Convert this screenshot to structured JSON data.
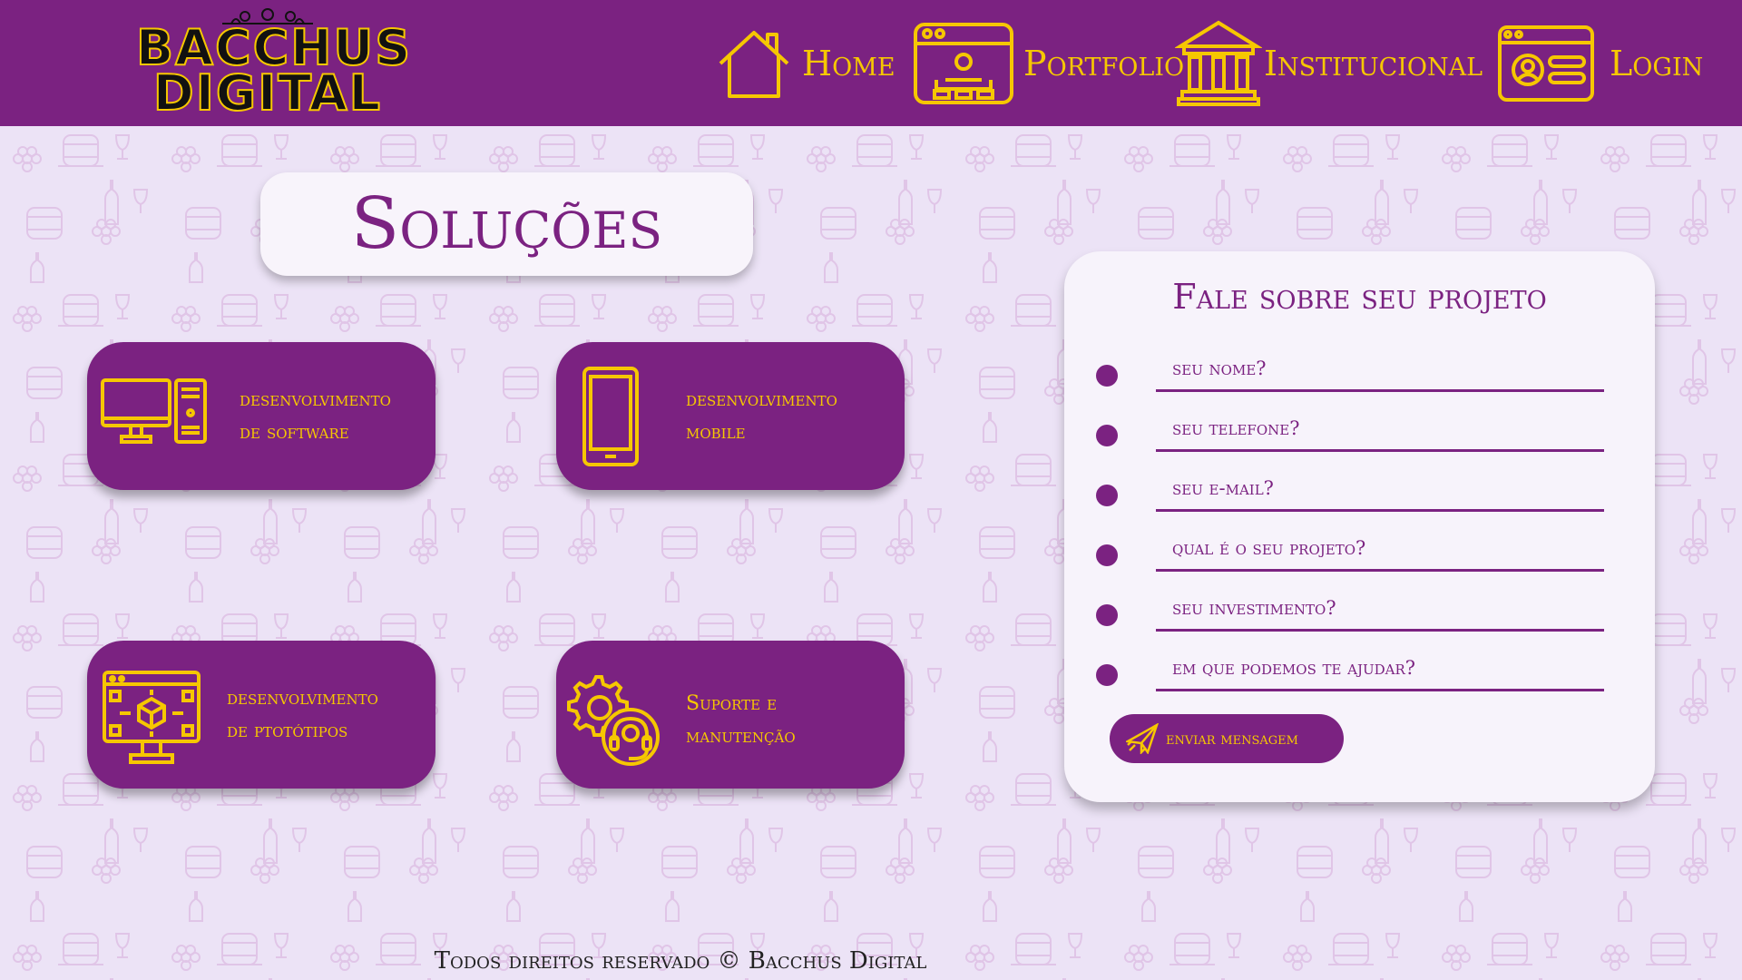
{
  "brand": {
    "name_line1": "BACCHUS",
    "name_line2": "DIGITAL"
  },
  "nav": {
    "items": [
      {
        "label": "Home",
        "icon": "house-icon"
      },
      {
        "label": "Portfolio",
        "icon": "browser-window-icon"
      },
      {
        "label": "Institucional",
        "icon": "building-columns-icon"
      },
      {
        "label": "Login",
        "icon": "profile-card-icon"
      }
    ]
  },
  "main": {
    "title": "Soluções",
    "cards": [
      {
        "label": "desenvolvimento\nde software",
        "icon": "desktop-computer-icon"
      },
      {
        "label": "desenvolvimento\nmobile",
        "icon": "smartphone-icon"
      },
      {
        "label": "desenvolvimento\nde ptotótipos",
        "icon": "prototype-monitor-icon"
      },
      {
        "label": "Suporte e\nmanutenção",
        "icon": "gear-headset-icon"
      }
    ]
  },
  "form": {
    "title": "Fale sobre seu projeto",
    "fields": [
      {
        "placeholder": "seu nome?"
      },
      {
        "placeholder": "seu telefone?"
      },
      {
        "placeholder": "seu e-mail?"
      },
      {
        "placeholder": "qual é o seu projeto?"
      },
      {
        "placeholder": "seu investimento?"
      },
      {
        "placeholder": "em que podemos te ajudar?"
      }
    ],
    "submit_label": "enviar mensagem",
    "submit_icon": "paper-plane-icon"
  },
  "footer": {
    "text": "Todos direitos reservado © Bacchus Digital"
  },
  "colors": {
    "primary": "#7b2281",
    "accent": "#f6c700",
    "background": "#ece3f6",
    "panel": "#f7f3fb"
  }
}
